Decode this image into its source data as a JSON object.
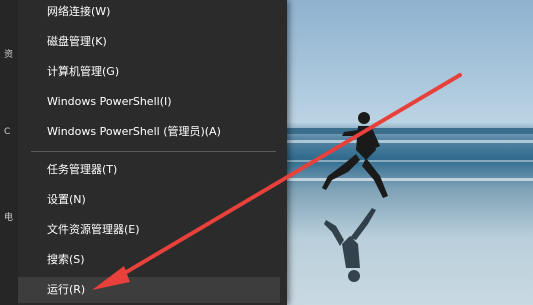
{
  "menu": {
    "items": [
      {
        "label": "网络连接(W)"
      },
      {
        "label": "磁盘管理(K)"
      },
      {
        "label": "计算机管理(G)"
      },
      {
        "label": "Windows PowerShell(I)"
      },
      {
        "label": "Windows PowerShell (管理员)(A)"
      },
      {
        "label": "任务管理器(T)"
      },
      {
        "label": "设置(N)"
      },
      {
        "label": "文件资源管理器(E)"
      },
      {
        "label": "搜索(S)"
      },
      {
        "label": "运行(R)"
      }
    ]
  },
  "strip_glyphs": [
    "资",
    "C",
    "电"
  ],
  "colors": {
    "menu_background": "#2b2b2b",
    "menu_text": "#ffffff",
    "highlight": "#3d3d3d",
    "arrow": "#e8403a"
  }
}
